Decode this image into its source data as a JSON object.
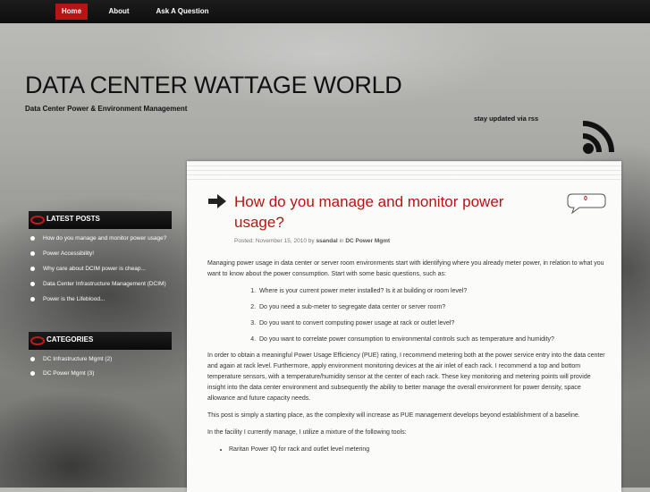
{
  "nav": {
    "home": "Home",
    "about": "About",
    "ask": "Ask A Question"
  },
  "site": {
    "title": "DATA CENTER WATTAGE WORLD",
    "description": "Data Center Power & Environment Management",
    "rss": "stay updated via rss"
  },
  "sidebar": {
    "latest_title": "LATEST POSTS",
    "latest": [
      "How do you manage and monitor power usage?",
      "Power Accessibility!",
      "Why care about DCIM power is cheap...",
      "Data Center Infrastructure Management (DCIM)",
      "Power is the Lifeblood..."
    ],
    "categories_title": "CATEGORIES",
    "categories": [
      "DC Infrastructure Mgmt (2)",
      "DC Power Mgmt (3)"
    ]
  },
  "post": {
    "title": "How do you manage and monitor power usage?",
    "comments": "0",
    "meta_prefix": "Posted: November 15, 2010 by",
    "author": "ssandal",
    "meta_in": "in",
    "category": "DC Power Mgmt",
    "intro": "Managing power usage in data center or server room environments start with identifying where you already meter power, in relation to what you want to know about the power consumption.  Start with some basic questions, such as:",
    "questions": [
      "Where is your current power meter installed?  Is it at building or room level?",
      "Do you need a sub-meter to segregate data center or server room?",
      "Do you want to convert computing power usage at rack or outlet level?",
      "Do you want to correlate power consumption to environmental controls such as temperature and humidity?"
    ],
    "para2": "In order to obtain a meaningful Power Usage Efficiency (PUE) rating, I recommend metering both at the power service entry into the data center and again at rack level.  Furthermore, apply environment monitoring devices at the air inlet of each rack.  I recommend a top and bottom temperature sensors, with a temperature/humidity sensor at the center of each rack.  These key monitoring and metering points will provide insight into the data center environment and subsequently the ability to better manage the overall environment for power density, space allowance and future capacity needs.",
    "para3": "This post is simply a starting place, as the complexity will increase as PUE management develops beyond establishment of a baseline.",
    "para4": "In the facility I currently manage, I utilize a mixture of the following tools:",
    "tools": [
      "Raritan Power IQ for rack and outlet level metering"
    ]
  },
  "colors": {
    "accent": "#b81414",
    "nav_bg": "#111111",
    "paper": "#fbfbf9"
  }
}
